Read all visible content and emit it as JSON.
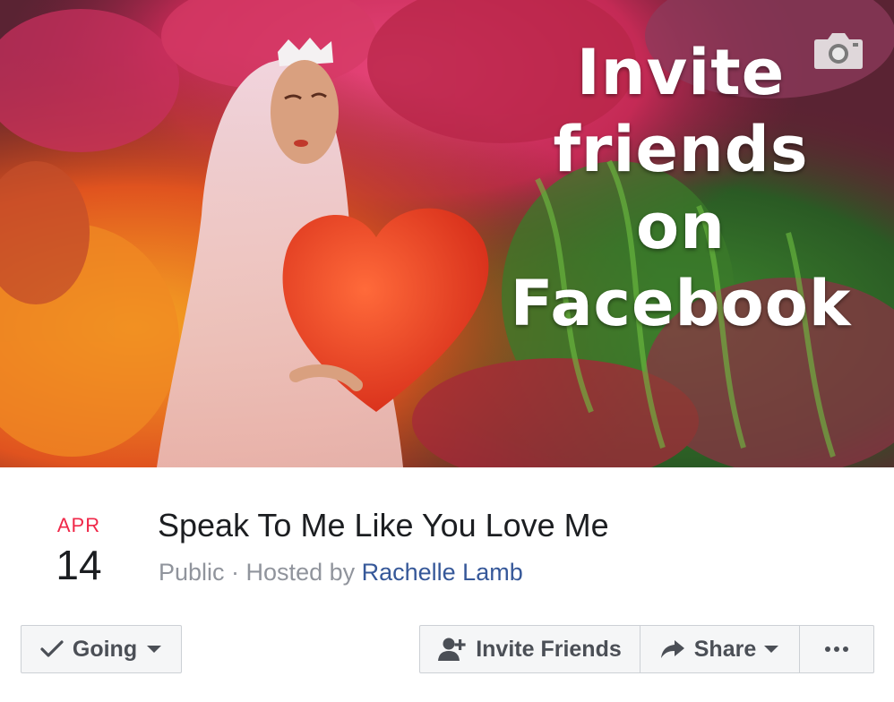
{
  "cover": {
    "overlay_lines": [
      "Invite",
      "friends",
      "on",
      "Facebook"
    ],
    "camera_icon": "camera-icon"
  },
  "event": {
    "month": "APR",
    "day": "14",
    "title": "Speak To Me Like You Love Me",
    "privacy": "Public",
    "separator": " · ",
    "hosted_by_prefix": "Hosted by ",
    "host": "Rachelle Lamb"
  },
  "actions": {
    "going_label": "Going",
    "invite_label": "Invite Friends",
    "share_label": "Share",
    "icons": {
      "going": "checkmark-icon",
      "going_caret": "caret-down-icon",
      "invite": "add-person-icon",
      "share": "share-arrow-icon",
      "share_caret": "caret-down-icon",
      "more": "more-dots-icon"
    }
  },
  "colors": {
    "date_month": "#f02849",
    "host_link": "#365899",
    "button_bg": "#f5f6f7",
    "button_text": "#4b4f56",
    "meta_text": "#90949c"
  }
}
